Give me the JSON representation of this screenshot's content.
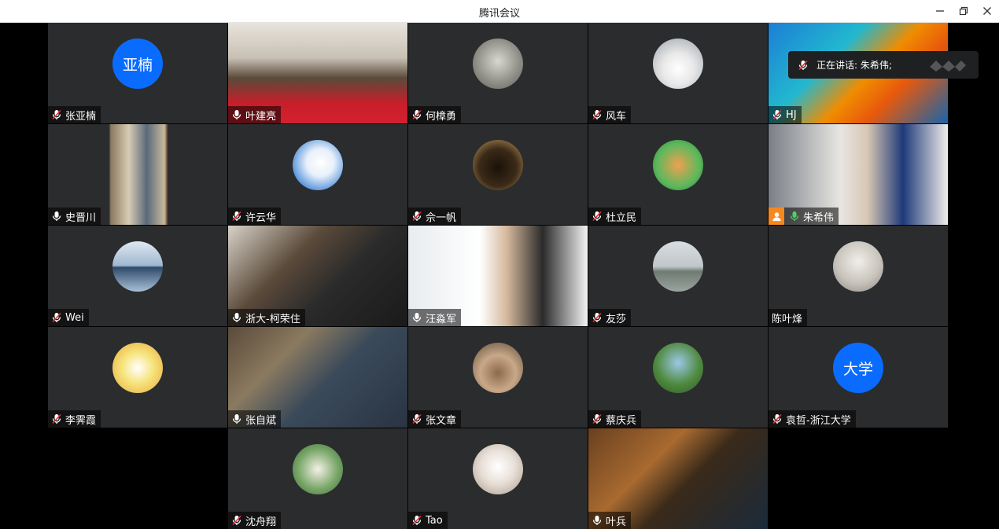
{
  "window": {
    "title": "腾讯会议"
  },
  "speaking_indicator": {
    "label": "正在讲话: 朱希伟;"
  },
  "colors": {
    "avatar_blue": "#0a6cff",
    "speaking_green": "#37b24d",
    "host_orange": "#f5891f",
    "tile_bg": "#2b2c2e"
  },
  "participants": [
    {
      "name": "张亚楠",
      "avatar_text": "亚楠",
      "mic": "muted"
    },
    {
      "name": "叶建亮",
      "mic": "on",
      "video": "person-red-jacket"
    },
    {
      "name": "何樟勇",
      "mic": "muted",
      "avatar_icon": "tiger-photo-icon"
    },
    {
      "name": "风车",
      "mic": "muted",
      "avatar_icon": "car-photo-icon"
    },
    {
      "name": "HJ",
      "mic": "muted",
      "video": "colorful-banner"
    },
    {
      "name": "史晋川",
      "mic": "on",
      "video": "bookshelf"
    },
    {
      "name": "许云华",
      "mic": "muted",
      "avatar_icon": "sky-clouds-icon"
    },
    {
      "name": "佘一帆",
      "mic": "muted",
      "avatar_icon": "beer-glass-icon"
    },
    {
      "name": "杜立民",
      "mic": "muted",
      "avatar_icon": "cartoon-fox-icon"
    },
    {
      "name": "朱希伟",
      "mic": "speaking",
      "host": true,
      "video": "person-glasses"
    },
    {
      "name": "Wei",
      "mic": "muted",
      "avatar_icon": "lake-reflection-icon"
    },
    {
      "name": "浙大-柯荣住",
      "mic": "on",
      "video": "person-bookshelf"
    },
    {
      "name": "汪淼军",
      "mic": "on",
      "video": "person-white-room"
    },
    {
      "name": "友莎",
      "mic": "muted",
      "avatar_icon": "misty-landscape-icon"
    },
    {
      "name": "陈叶烽",
      "mic": "none",
      "avatar_icon": "person-arms-open-icon"
    },
    {
      "name": "李霁霞",
      "mic": "muted",
      "avatar_icon": "cartoon-duck-icon"
    },
    {
      "name": "张自斌",
      "mic": "on",
      "video": "person-library"
    },
    {
      "name": "张文章",
      "mic": "muted",
      "avatar_icon": "teacup-icon"
    },
    {
      "name": "蔡庆兵",
      "mic": "muted",
      "avatar_icon": "garden-trees-icon"
    },
    {
      "name": "袁哲-浙江大学",
      "avatar_text": "大学",
      "mic": "muted"
    },
    {
      "name": "沈舟翔",
      "mic": "muted",
      "avatar_icon": "person-sitting-icon"
    },
    {
      "name": "Tao",
      "mic": "muted",
      "avatar_icon": "cat-photo-icon"
    },
    {
      "name": "叶兵",
      "mic": "on",
      "video": "person-books-wall"
    }
  ]
}
